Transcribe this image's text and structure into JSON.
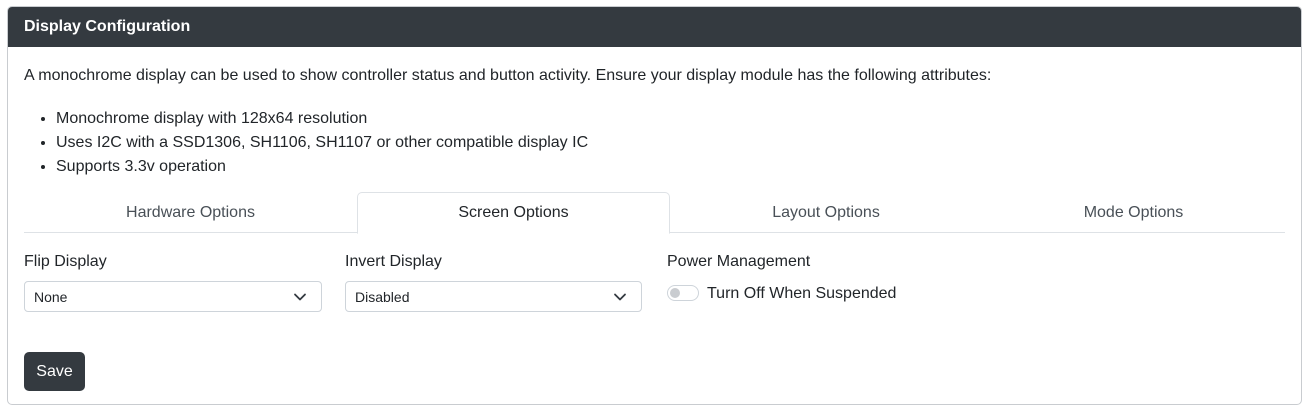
{
  "card": {
    "title": "Display Configuration",
    "intro": "A monochrome display can be used to show controller status and button activity. Ensure your display module has the following attributes:",
    "attributes": [
      "Monochrome display with 128x64 resolution",
      "Uses I2C with a SSD1306, SH1106, SH1107 or other compatible display IC",
      "Supports 3.3v operation"
    ]
  },
  "tabs": [
    {
      "label": "Hardware Options",
      "active": false
    },
    {
      "label": "Screen Options",
      "active": true
    },
    {
      "label": "Layout Options",
      "active": false
    },
    {
      "label": "Mode Options",
      "active": false
    }
  ],
  "screen_options": {
    "flip_display": {
      "label": "Flip Display",
      "value": "None"
    },
    "invert_display": {
      "label": "Invert Display",
      "value": "Disabled"
    },
    "power_management": {
      "label": "Power Management",
      "toggle_label": "Turn Off When Suspended",
      "checked": false
    }
  },
  "save_label": "Save",
  "colors": {
    "header_bg": "#343a40",
    "button_bg": "#343a40",
    "border": "#dee2e6"
  }
}
